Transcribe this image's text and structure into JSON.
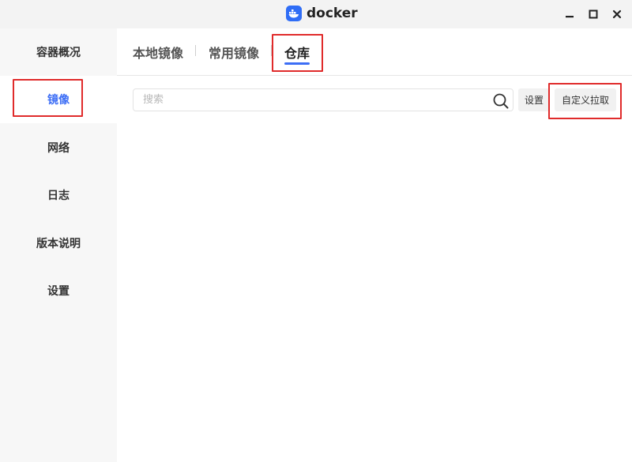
{
  "window": {
    "title": "docker",
    "icons": [
      "docker-icon",
      "minimize-icon",
      "maximize-icon",
      "close-icon"
    ]
  },
  "sidebar": {
    "items": [
      {
        "label": "容器概况",
        "active": false
      },
      {
        "label": "镜像",
        "active": true
      },
      {
        "label": "网络",
        "active": false
      },
      {
        "label": "日志",
        "active": false
      },
      {
        "label": "版本说明",
        "active": false
      },
      {
        "label": "设置",
        "active": false
      }
    ]
  },
  "tabs": [
    {
      "label": "本地镜像",
      "active": false
    },
    {
      "label": "常用镜像",
      "active": false
    },
    {
      "label": "仓库",
      "active": true
    }
  ],
  "toolbar": {
    "search_placeholder": "搜索",
    "settings_label": "设置",
    "custom_pull_label": "自定义拉取"
  },
  "colors": {
    "accent": "#3d6ef5",
    "highlight": "#e02b2b",
    "sidebar_bg": "#f7f7f7",
    "titlebar_bg": "#f3f3f3"
  }
}
